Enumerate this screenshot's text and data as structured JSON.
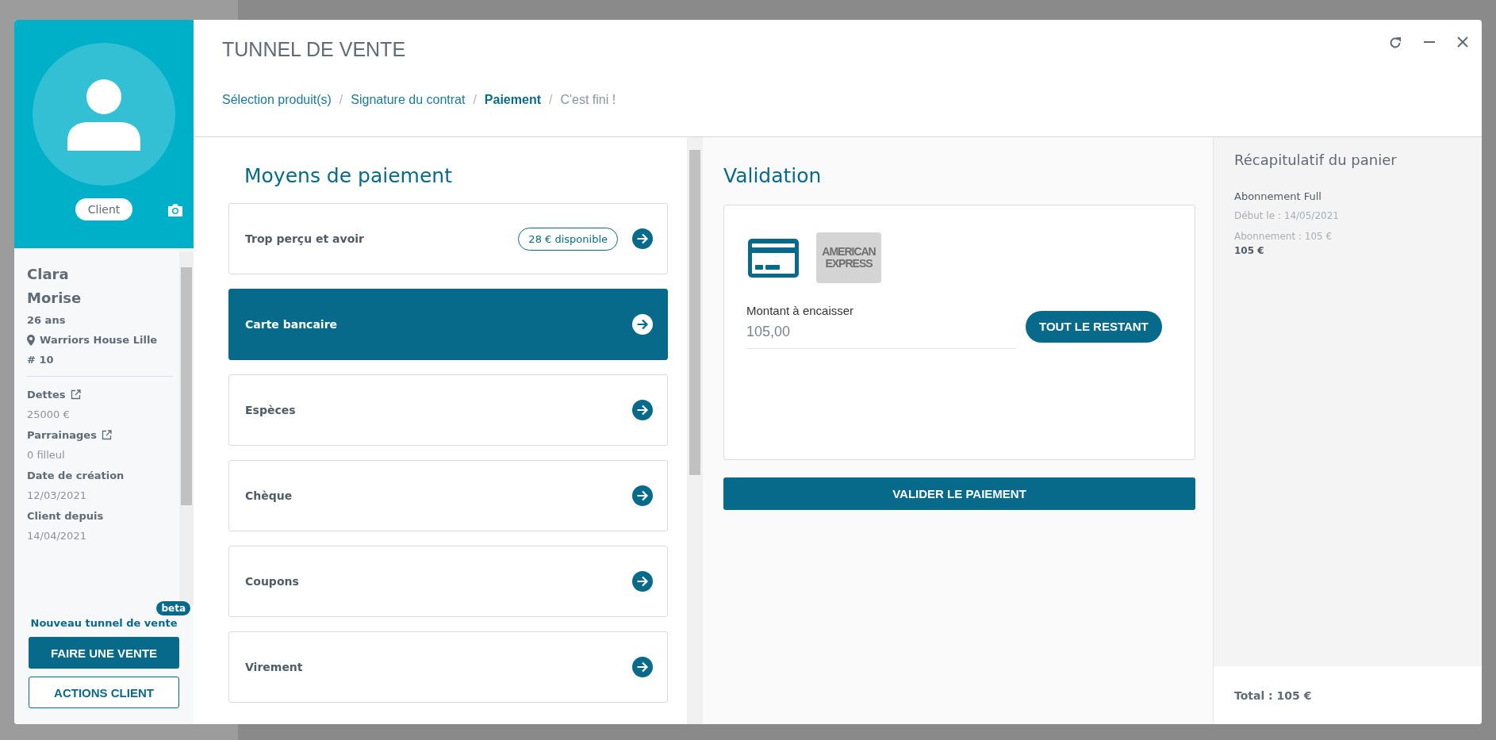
{
  "profile": {
    "badge": "Client",
    "first_name": "Clara",
    "last_name": "Morise",
    "age": "26 ans",
    "location": "Warriors House Lille",
    "number": "# 10",
    "fields": [
      {
        "label": "Dettes",
        "link": true,
        "value": "25000 €"
      },
      {
        "label": "Parrainages",
        "link": true,
        "value": "0 filleul"
      },
      {
        "label": "Date de création",
        "link": false,
        "value": "12/03/2021"
      },
      {
        "label": "Client depuis",
        "link": false,
        "value": "14/04/2021"
      }
    ],
    "new_tunnel_link": "Nouveau tunnel de vente",
    "beta_badge": "beta",
    "primary_button": "FAIRE UNE VENTE",
    "secondary_button": "ACTIONS CLIENT"
  },
  "window": {
    "title": "TUNNEL DE VENTE"
  },
  "breadcrumb": [
    {
      "label": "Sélection produit(s)",
      "completed": true,
      "selected": false
    },
    {
      "separator": "/",
      "label": "Signature du contrat",
      "completed": true,
      "selected": false
    },
    {
      "separator": "/",
      "label": "Paiement",
      "selected": true
    },
    {
      "separator": "/",
      "label": "C'est fini !",
      "completed": false,
      "selected": false
    }
  ],
  "payment_methods": {
    "title": "Moyens de paiement",
    "items": [
      {
        "label": "Trop perçu et avoir",
        "badge": "28 € disponible",
        "selected": false
      },
      {
        "label": "Carte bancaire",
        "selected": true
      },
      {
        "label": "Espèces",
        "selected": false
      },
      {
        "label": "Chèque",
        "selected": false
      },
      {
        "label": "Coupons",
        "selected": false
      },
      {
        "label": "Virement",
        "selected": false
      }
    ]
  },
  "validation": {
    "title": "Validation",
    "cards": [
      {
        "kind": "card",
        "selected": true
      },
      {
        "kind": "amex",
        "text": "AMERICAN EXPRESS",
        "selected": false
      }
    ],
    "amount_label": "Montant à encaisser",
    "amount_value": "105,00",
    "remaining_button": "TOUT LE RESTANT",
    "submit_button": "VALIDER LE PAIEMENT"
  },
  "summary": {
    "title": "Récapitulatif du panier",
    "items": [
      {
        "name": "Abonnement Full",
        "start": "Début le : 14/05/2021",
        "detail": "Abonnement : 105 €",
        "price": "105 €"
      }
    ],
    "total": "Total : 105 €"
  }
}
